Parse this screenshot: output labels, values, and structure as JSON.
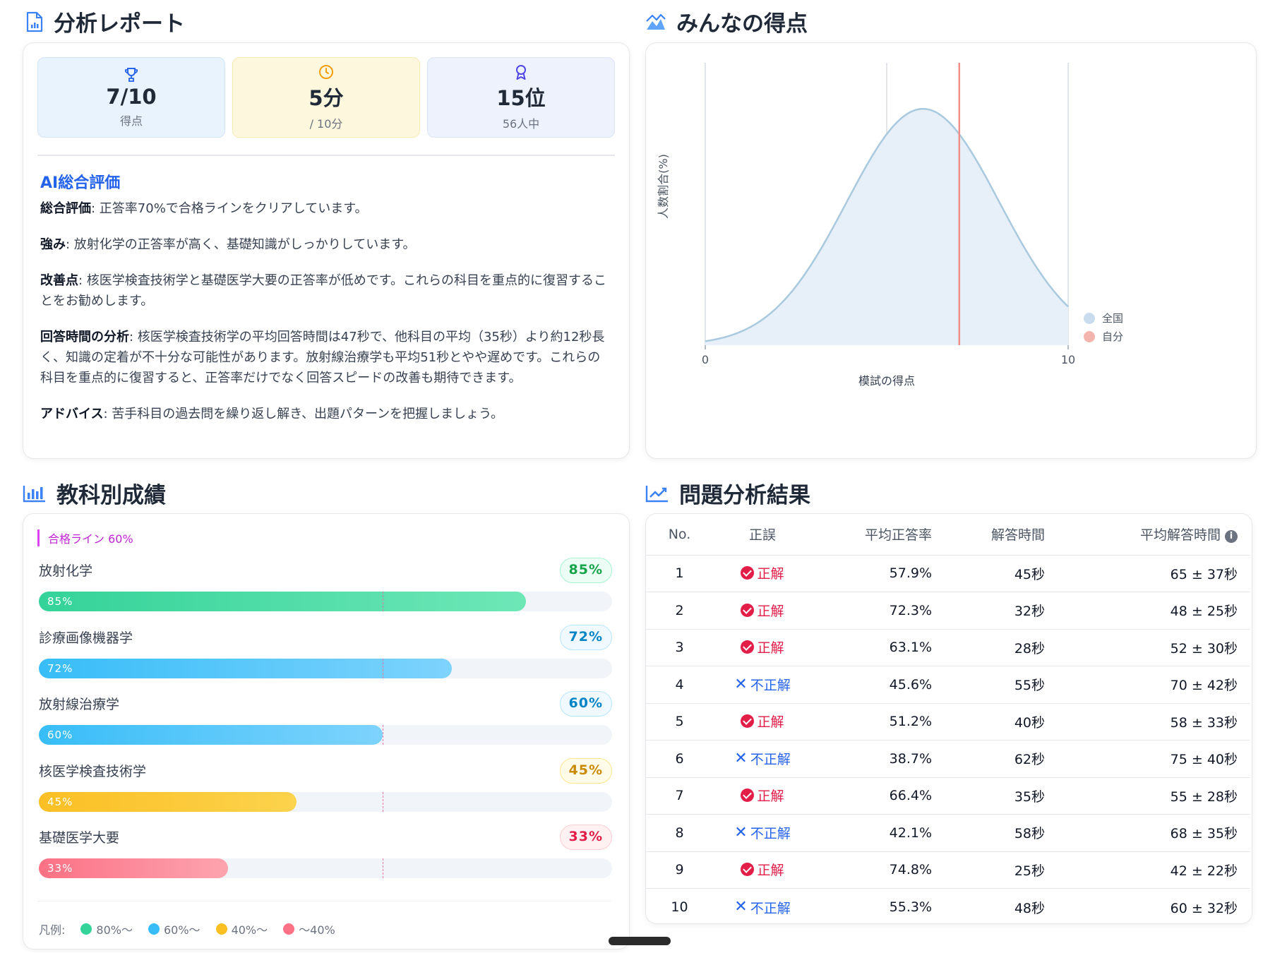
{
  "report": {
    "title": "分析レポート",
    "stats": [
      {
        "icon": "trophy-icon",
        "value": "7/10",
        "label": "得点"
      },
      {
        "icon": "clock-icon",
        "value": "5分",
        "label": "/ 10分"
      },
      {
        "icon": "award-icon",
        "value": "15位",
        "label": "56人中"
      }
    ],
    "ai_title": "AI総合評価",
    "paragraphs": [
      {
        "head": "総合評価",
        "text": ": 正答率70%で合格ラインをクリアしています。"
      },
      {
        "head": "強み",
        "text": ": 放射化学の正答率が高く、基礎知識がしっかりしています。"
      },
      {
        "head": "改善点",
        "text": ": 核医学検査技術学と基礎医学大要の正答率が低めです。これらの科目を重点的に復習することをお勧めします。"
      },
      {
        "head": "回答時間の分析",
        "text": ": 核医学検査技術学の平均回答時間は47秒で、他科目の平均（35秒）より約12秒長く、知識の定着が不十分な可能性があります。放射線治療学も平均51秒とやや遅めです。これらの科目を重点的に復習すると、正答率だけでなく回答スピードの改善も期待できます。"
      },
      {
        "head": "アドバイス",
        "text": ": 苦手科目の過去問を繰り返し解き、出題パターンを把握しましょう。"
      }
    ]
  },
  "distribution": {
    "title": "みんなの得点",
    "ylabel": "人数割合(%)",
    "xlabel": "模試の得点",
    "xticks": [
      "0",
      "10"
    ],
    "legend": [
      {
        "name": "全国",
        "color": "#c9dced"
      },
      {
        "name": "自分",
        "color": "#f4b4ae"
      }
    ]
  },
  "chart_data": {
    "type": "area",
    "xlim": [
      0,
      10
    ],
    "ylim": [
      0,
      1
    ],
    "grid": true,
    "series": [
      {
        "name": "全国",
        "distribution": "normal",
        "mean": 6,
        "sd": 2.1,
        "color": "#a9c9de"
      }
    ],
    "marker": {
      "name": "自分",
      "x": 7,
      "color": "#f08f86"
    },
    "gridlines_x": [
      0,
      5,
      10
    ],
    "xlabel": "模試の得点",
    "ylabel": "人数割合(%)"
  },
  "subjects": {
    "title": "教科別成績",
    "pass_line_label": "合格ライン 60%",
    "pass_line": 60,
    "items": [
      {
        "name": "放射化学",
        "value": 85,
        "label": "85%",
        "color_from": "#34d399",
        "color_to": "#6ee7b7",
        "badge_color": "#16a34a",
        "badge_bg": "#ecfdf5",
        "badge_border": "#a7f3d0"
      },
      {
        "name": "診療画像機器学",
        "value": 72,
        "label": "72%",
        "color_from": "#38bdf8",
        "color_to": "#7dd3fc",
        "badge_color": "#0284c7",
        "badge_bg": "#f0f9ff",
        "badge_border": "#bae6fd"
      },
      {
        "name": "放射線治療学",
        "value": 60,
        "label": "60%",
        "color_from": "#38bdf8",
        "color_to": "#7dd3fc",
        "badge_color": "#0284c7",
        "badge_bg": "#f0f9ff",
        "badge_border": "#bae6fd"
      },
      {
        "name": "核医学検査技術学",
        "value": 45,
        "label": "45%",
        "color_from": "#fbbf24",
        "color_to": "#fcd34d",
        "badge_color": "#ca8a04",
        "badge_bg": "#fefce8",
        "badge_border": "#fde68a"
      },
      {
        "name": "基礎医学大要",
        "value": 33,
        "label": "33%",
        "color_from": "#fb7185",
        "color_to": "#fda4af",
        "badge_color": "#e11d48",
        "badge_bg": "#fff1f2",
        "badge_border": "#fecdd3"
      }
    ],
    "legend_label": "凡例:",
    "legend": [
      {
        "label": "80%〜",
        "color": "#34d399"
      },
      {
        "label": "60%〜",
        "color": "#38bdf8"
      },
      {
        "label": "40%〜",
        "color": "#fbbf24"
      },
      {
        "label": "〜40%",
        "color": "#fb7185"
      }
    ]
  },
  "analysis": {
    "title": "問題分析結果",
    "headers": {
      "no": "No.",
      "result": "正誤",
      "rate": "平均正答率",
      "time": "解答時間",
      "avg": "平均解答時間"
    },
    "rows": [
      {
        "no": "1",
        "correct": true,
        "result": "正解",
        "rate": "57.9%",
        "time": "45秒",
        "avg": "65 ± 37秒"
      },
      {
        "no": "2",
        "correct": true,
        "result": "正解",
        "rate": "72.3%",
        "time": "32秒",
        "avg": "48 ± 25秒"
      },
      {
        "no": "3",
        "correct": true,
        "result": "正解",
        "rate": "63.1%",
        "time": "28秒",
        "avg": "52 ± 30秒"
      },
      {
        "no": "4",
        "correct": false,
        "result": "不正解",
        "rate": "45.6%",
        "time": "55秒",
        "avg": "70 ± 42秒"
      },
      {
        "no": "5",
        "correct": true,
        "result": "正解",
        "rate": "51.2%",
        "time": "40秒",
        "avg": "58 ± 33秒"
      },
      {
        "no": "6",
        "correct": false,
        "result": "不正解",
        "rate": "38.7%",
        "time": "62秒",
        "avg": "75 ± 40秒"
      },
      {
        "no": "7",
        "correct": true,
        "result": "正解",
        "rate": "66.4%",
        "time": "35秒",
        "avg": "55 ± 28秒"
      },
      {
        "no": "8",
        "correct": false,
        "result": "不正解",
        "rate": "42.1%",
        "time": "58秒",
        "avg": "68 ± 35秒"
      },
      {
        "no": "9",
        "correct": true,
        "result": "正解",
        "rate": "74.8%",
        "time": "25秒",
        "avg": "42 ± 22秒"
      },
      {
        "no": "10",
        "correct": false,
        "result": "不正解",
        "rate": "55.3%",
        "time": "48秒",
        "avg": "60 ± 32秒"
      }
    ]
  }
}
